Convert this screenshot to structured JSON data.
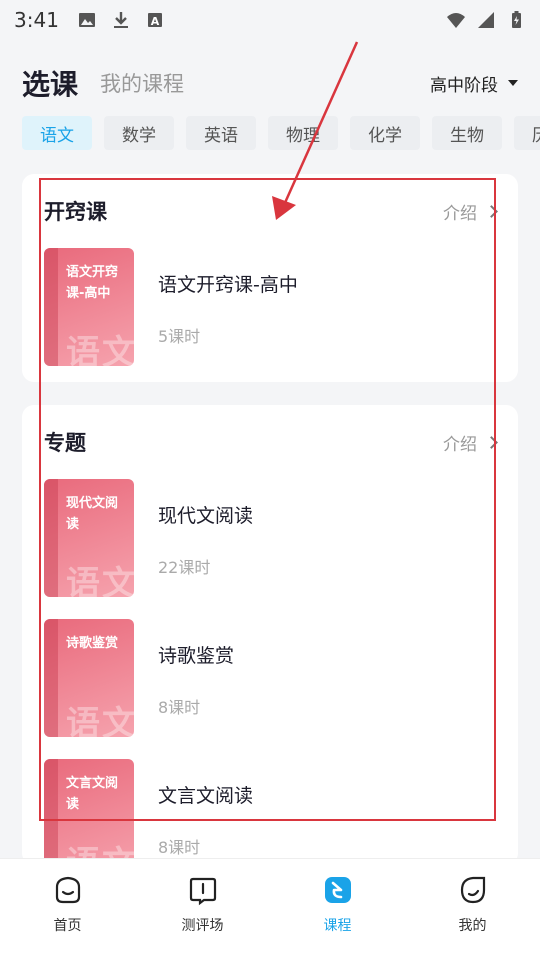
{
  "status_bar": {
    "time": "3:41",
    "icons_left": [
      "image-icon",
      "download-icon",
      "a-box-icon"
    ],
    "icons_right": [
      "wifi-icon",
      "signal-icon",
      "battery-icon"
    ]
  },
  "header": {
    "title": "选课",
    "my_courses": "我的课程",
    "stage": "高中阶段"
  },
  "subjects": [
    "语文",
    "数学",
    "英语",
    "物理",
    "化学",
    "生物",
    "历史"
  ],
  "active_subject": 0,
  "sections": [
    {
      "title": "开窍课",
      "intro": "介绍",
      "courses": [
        {
          "cover_title": "语文开窍课-高中",
          "watermark": "语文",
          "name": "语文开窍课-高中",
          "lessons": "5课时"
        }
      ]
    },
    {
      "title": "专题",
      "intro": "介绍",
      "courses": [
        {
          "cover_title": "现代文阅读",
          "watermark": "语文",
          "name": "现代文阅读",
          "lessons": "22课时"
        },
        {
          "cover_title": "诗歌鉴赏",
          "watermark": "语文",
          "name": "诗歌鉴赏",
          "lessons": "8课时"
        },
        {
          "cover_title": "文言文阅读",
          "watermark": "语文",
          "name": "文言文阅读",
          "lessons": "8课时"
        }
      ]
    }
  ],
  "bottom_nav": [
    {
      "label": "首页",
      "icon": "home-face-icon"
    },
    {
      "label": "测评场",
      "icon": "book-icon"
    },
    {
      "label": "课程",
      "icon": "course-icon"
    },
    {
      "label": "我的",
      "icon": "profile-face-icon"
    }
  ],
  "active_nav": 2,
  "colors": {
    "accent": "#1aa3e8",
    "annotation": "#d9363e",
    "cover": "#e96a7c"
  }
}
